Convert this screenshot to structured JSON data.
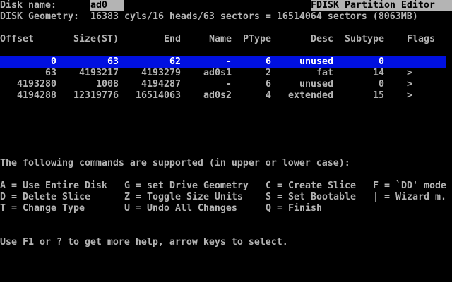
{
  "header": {
    "disk_name_label": "Disk name:",
    "disk_name_value": "ad0",
    "title": "FDISK Partition Editor",
    "geometry_label": "DISK Geometry:",
    "geometry_value": "16383 cyls/16 heads/63 sectors = 16514064 sectors (8063MB)"
  },
  "table": {
    "columns": [
      "Offset",
      "Size(ST)",
      "End",
      "Name",
      "PType",
      "Desc",
      "Subtype",
      "Flags"
    ],
    "rows": [
      {
        "offset": "0",
        "size": "63",
        "end": "62",
        "name": "-",
        "ptype": "6",
        "desc": "unused",
        "subtype": "0",
        "flags": "",
        "selected": true
      },
      {
        "offset": "63",
        "size": "4193217",
        "end": "4193279",
        "name": "ad0s1",
        "ptype": "2",
        "desc": "fat",
        "subtype": "14",
        "flags": ">",
        "selected": false
      },
      {
        "offset": "4193280",
        "size": "1008",
        "end": "4194287",
        "name": "-",
        "ptype": "6",
        "desc": "unused",
        "subtype": "0",
        "flags": ">",
        "selected": false
      },
      {
        "offset": "4194288",
        "size": "12319776",
        "end": "16514063",
        "name": "ad0s2",
        "ptype": "4",
        "desc": "extended",
        "subtype": "15",
        "flags": ">",
        "selected": false
      }
    ]
  },
  "commands": {
    "intro": "The following commands are supported (in upper or lower case):",
    "lines": [
      [
        "A = Use Entire Disk",
        "G = set Drive Geometry",
        "C = Create Slice",
        "F = `DD' mode"
      ],
      [
        "D = Delete Slice",
        "Z = Toggle Size Units",
        "S = Set Bootable",
        "| = Wizard m."
      ],
      [
        "T = Change Type",
        "U = Undo All Changes",
        "Q = Finish"
      ]
    ]
  },
  "footer": {
    "help_text": "Use F1 or ? to get more help, arrow keys to select."
  },
  "colors": {
    "background": "#000000",
    "text": "#b4b4b4",
    "reverse_bg": "#b4b4b4",
    "reverse_text": "#000000",
    "selected_bg": "#0010e0",
    "selected_text": "#ffffff"
  }
}
